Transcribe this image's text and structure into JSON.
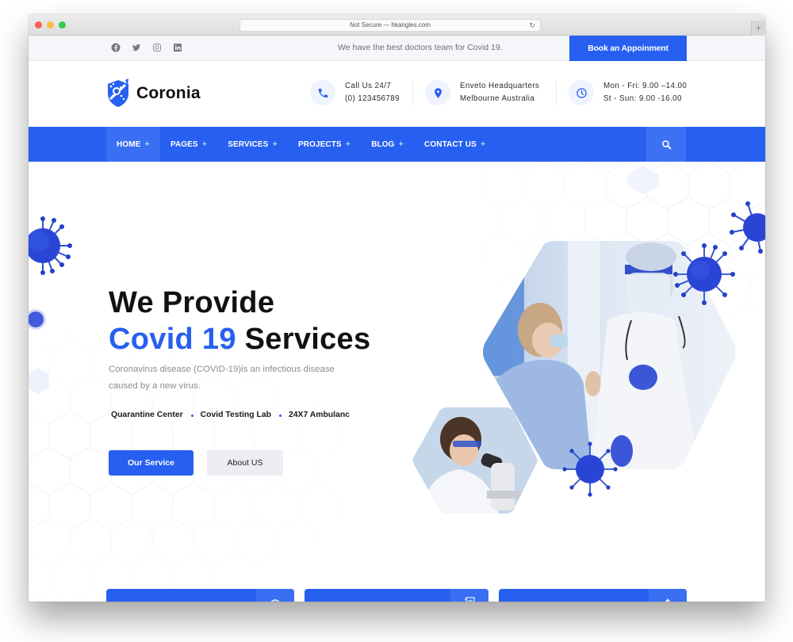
{
  "browser": {
    "url_text": "Not Secure — hkangles.com",
    "reload_icon": "reload-icon",
    "new_tab_icon": "plus-icon"
  },
  "topbar": {
    "socials": [
      {
        "name": "facebook",
        "icon": "facebook-icon"
      },
      {
        "name": "twitter",
        "icon": "twitter-icon"
      },
      {
        "name": "instagram",
        "icon": "instagram-icon"
      },
      {
        "name": "linkedin",
        "icon": "linkedin-icon"
      }
    ],
    "tagline": "We have the best doctors team for Covid 19.",
    "cta_label": "Book an Appoinment"
  },
  "header": {
    "logo_text": "Coronia",
    "contacts": [
      {
        "icon": "phone-icon",
        "line1": "Call Us 24/7",
        "line2": "(0) 123456789"
      },
      {
        "icon": "location-pin-icon",
        "line1": "Enveto Headquarters",
        "line2": "Melbourne Australia"
      },
      {
        "icon": "clock-icon",
        "line1": "Mon - Fri: 9.00 –14.00",
        "line2": "St - Sun: 9.00 -16.00"
      }
    ]
  },
  "nav": {
    "items": [
      {
        "label": "HOME",
        "active": true
      },
      {
        "label": "PAGES"
      },
      {
        "label": "SERVICES"
      },
      {
        "label": "PROJECTS"
      },
      {
        "label": "BLOG"
      },
      {
        "label": "CONTACT US"
      }
    ],
    "plus": "+",
    "search_icon": "search-icon"
  },
  "hero": {
    "title_line1": "We Provide",
    "title_accent": "Covid 19",
    "title_rest": " Services",
    "description": "Coronavirus disease (COVID-19)is an infectious disease caused by a new virus.",
    "features": [
      "Quarantine Center",
      "Covid Testing Lab",
      "24X7 Ambulanc"
    ],
    "primary_button": "Our Service",
    "secondary_button": "About US"
  },
  "colors": {
    "accent": "#2760f0",
    "nav_active": "#3a6ff3",
    "topbar_bg": "#f5f6f9",
    "text_dark": "#111111",
    "text_muted": "#8a8c96"
  },
  "service_cards": [
    {
      "icon": "globe-icon"
    },
    {
      "icon": "document-icon"
    },
    {
      "icon": "shield-icon"
    }
  ]
}
